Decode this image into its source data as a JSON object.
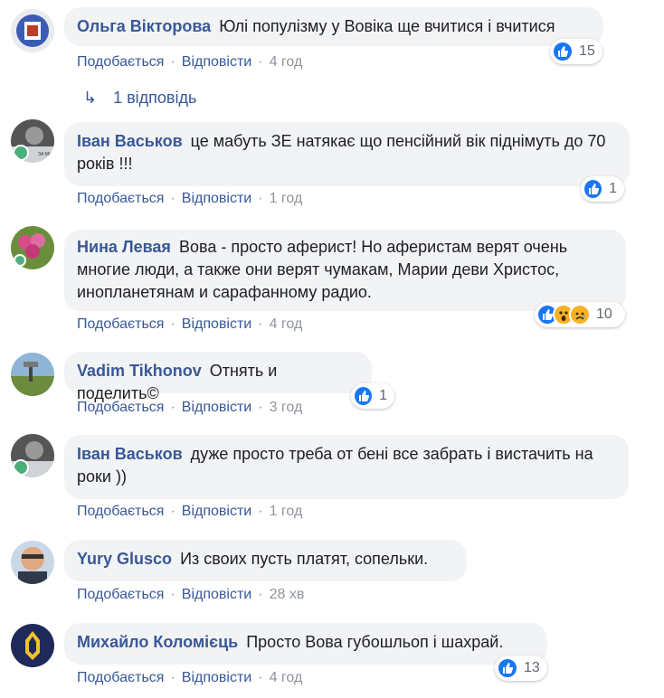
{
  "actions": {
    "like": "Подобається",
    "reply": "Відповісти",
    "separator": "·"
  },
  "replies_link": {
    "label": "1 відповідь",
    "icon": "reply-arrow-icon"
  },
  "comments": [
    {
      "author": "Ольга Вікторова",
      "text": "Юлі популізму у Вовіка ще вчитися і вчитися",
      "time": "4 год",
      "reaction_count": "15",
      "reactions": [
        "like"
      ]
    },
    {
      "author": "Іван Васьков",
      "text": "це мабуть ЗЕ натякає що пенсійний вік піднімуть до 70 років !!!",
      "time": "1 год",
      "reaction_count": "1",
      "reactions": [
        "like"
      ]
    },
    {
      "author": "Нина Левая",
      "text": "Вова - просто аферист! Но аферистам верят очень многие люди, а также они верят чумакам, Марии деви Христос, инопланетянам и сарафанному радио.",
      "time": "4 год",
      "reaction_count": "10",
      "reactions": [
        "like",
        "wow",
        "sad"
      ]
    },
    {
      "author": "Vadim Tikhonov",
      "text": "Отнять и поделить©",
      "time": "3 год",
      "reaction_count": "1",
      "reactions": [
        "like"
      ]
    },
    {
      "author": "Іван Васьков",
      "text": "дуже просто треба от бені все забрать і вистачить на роки ))",
      "time": "1 год",
      "reaction_count": "",
      "reactions": []
    },
    {
      "author": "Yury Glusco",
      "text": "Из своих пусть платят, сопельки.",
      "time": "28 хв",
      "reaction_count": "",
      "reactions": []
    },
    {
      "author": "Михайло Коломієць",
      "text": "Просто Вова губошльоп і шахрай.",
      "time": "4 год",
      "reaction_count": "13",
      "reactions": [
        "like"
      ]
    }
  ],
  "colors": {
    "link": "#385898",
    "bubble": "#f2f3f5",
    "meta": "#90949c",
    "like": "#1877f2",
    "wow": "#f7b125"
  }
}
